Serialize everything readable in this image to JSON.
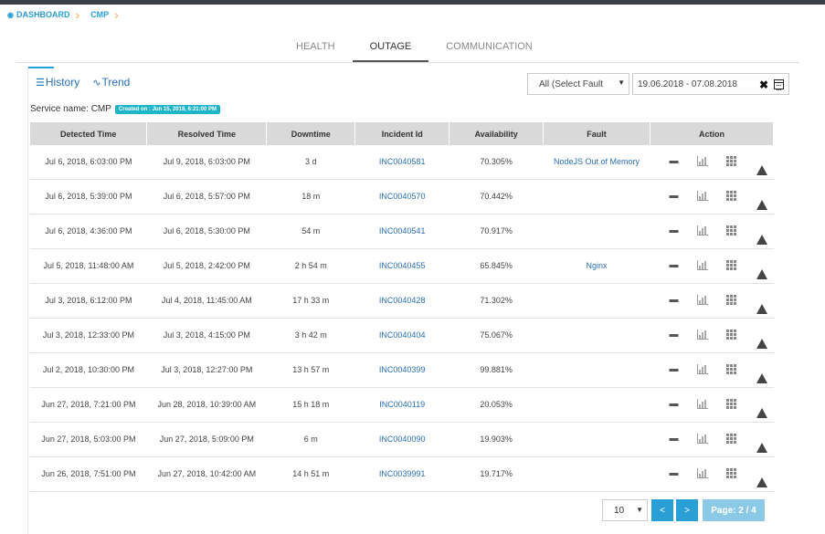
{
  "breadcrumb": {
    "items": [
      "DASHBOARD",
      "CMP"
    ]
  },
  "tabs": [
    {
      "label": "HEALTH",
      "active": false
    },
    {
      "label": "OUTAGE",
      "active": true
    },
    {
      "label": "COMMUNICATION",
      "active": false
    }
  ],
  "views": {
    "history": "History",
    "trend": "Trend"
  },
  "filters": {
    "fault_selected": "All (Select Fault",
    "date_range": "19.06.2018 - 07.08.2018"
  },
  "service": {
    "label": "Service name: CMP",
    "created": "Created on : Jun 15, 2018, 6:21:00 PM"
  },
  "table": {
    "headers": [
      "Detected Time",
      "Resolved Time",
      "Downtime",
      "Incident Id",
      "Availability",
      "Fault",
      "Action"
    ],
    "rows": [
      {
        "detected": "Jul 6, 2018, 6:03:00 PM",
        "resolved": "Jul 9, 2018, 6:03:00 PM",
        "downtime": "3 d",
        "incident": "INC0040581",
        "availability": "70.305%",
        "fault": "NodeJS Out of Memory"
      },
      {
        "detected": "Jul 6, 2018, 5:39:00 PM",
        "resolved": "Jul 6, 2018, 5:57:00 PM",
        "downtime": "18 m",
        "incident": "INC0040570",
        "availability": "70.442%",
        "fault": ""
      },
      {
        "detected": "Jul 6, 2018, 4:36:00 PM",
        "resolved": "Jul 6, 2018, 5:30:00 PM",
        "downtime": "54 m",
        "incident": "INC0040541",
        "availability": "70.917%",
        "fault": ""
      },
      {
        "detected": "Jul 5, 2018, 11:48:00 AM",
        "resolved": "Jul 5, 2018, 2:42:00 PM",
        "downtime": "2 h 54 m",
        "incident": "INC0040455",
        "availability": "65.845%",
        "fault": "Nginx"
      },
      {
        "detected": "Jul 3, 2018, 6:12:00 PM",
        "resolved": "Jul 4, 2018, 11:45:00 AM",
        "downtime": "17 h 33 m",
        "incident": "INC0040428",
        "availability": "71.302%",
        "fault": ""
      },
      {
        "detected": "Jul 3, 2018, 12:33:00 PM",
        "resolved": "Jul 3, 2018, 4:15:00 PM",
        "downtime": "3 h 42 m",
        "incident": "INC0040404",
        "availability": "75.067%",
        "fault": ""
      },
      {
        "detected": "Jul 2, 2018, 10:30:00 PM",
        "resolved": "Jul 3, 2018, 12:27:00 PM",
        "downtime": "13 h 57 m",
        "incident": "INC0040399",
        "availability": "99.881%",
        "fault": ""
      },
      {
        "detected": "Jun 27, 2018, 7:21:00 PM",
        "resolved": "Jun 28, 2018, 10:39:00 AM",
        "downtime": "15 h 18 m",
        "incident": "INC0040119",
        "availability": "20.053%",
        "fault": ""
      },
      {
        "detected": "Jun 27, 2018, 5:03:00 PM",
        "resolved": "Jun 27, 2018, 5:09:00 PM",
        "downtime": "6 m",
        "incident": "INC0040090",
        "availability": "19.903%",
        "fault": ""
      },
      {
        "detected": "Jun 26, 2018, 7:51:00 PM",
        "resolved": "Jun 27, 2018, 10:42:00 AM",
        "downtime": "14 h 51 m",
        "incident": "INC0039991",
        "availability": "19.717%",
        "fault": ""
      }
    ]
  },
  "pager": {
    "page_size": "10",
    "prev": "<",
    "next": ">",
    "info": "Page: 2 / 4"
  },
  "colors": {
    "accent": "#2a9fd6",
    "badge": "#1fb5c9",
    "header_bg": "#d9d9d9"
  }
}
